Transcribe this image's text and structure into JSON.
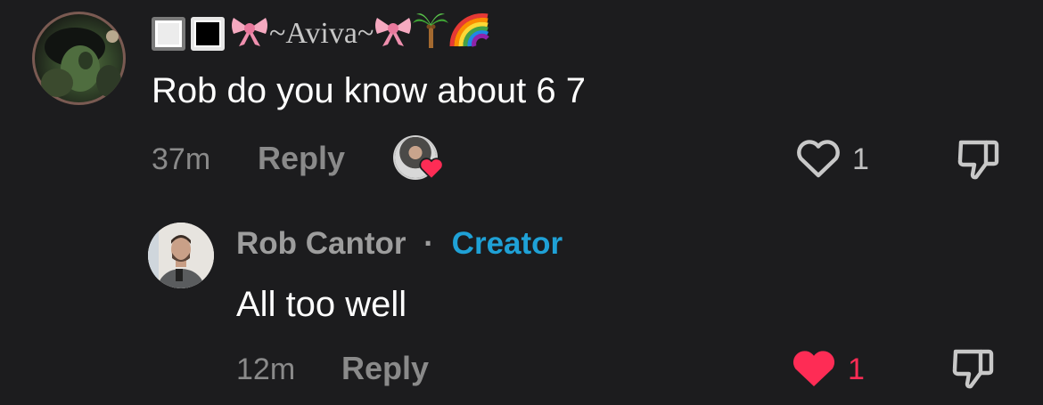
{
  "comment": {
    "username_prefix_icons": [
      "white-square-icon",
      "black-square-icon",
      "ribbon-icon"
    ],
    "username": "~Aviva~",
    "username_suffix_icons": [
      "ribbon-icon",
      "palm-tree-icon",
      "rainbow-icon"
    ],
    "text": "Rob do you know about 6 7",
    "time": "37m",
    "reply_label": "Reply",
    "creator_liked": true,
    "likes": "1",
    "liked_by_viewer": false
  },
  "reply": {
    "author": "Rob Cantor",
    "separator": "·",
    "badge": "Creator",
    "text": "All too well",
    "time": "12m",
    "reply_label": "Reply",
    "likes": "1",
    "liked_by_viewer": true
  },
  "colors": {
    "background": "#1c1c1e",
    "creator_badge": "#1fa1d6",
    "like_active": "#fe2c55",
    "muted_text": "#8a8a8a"
  }
}
